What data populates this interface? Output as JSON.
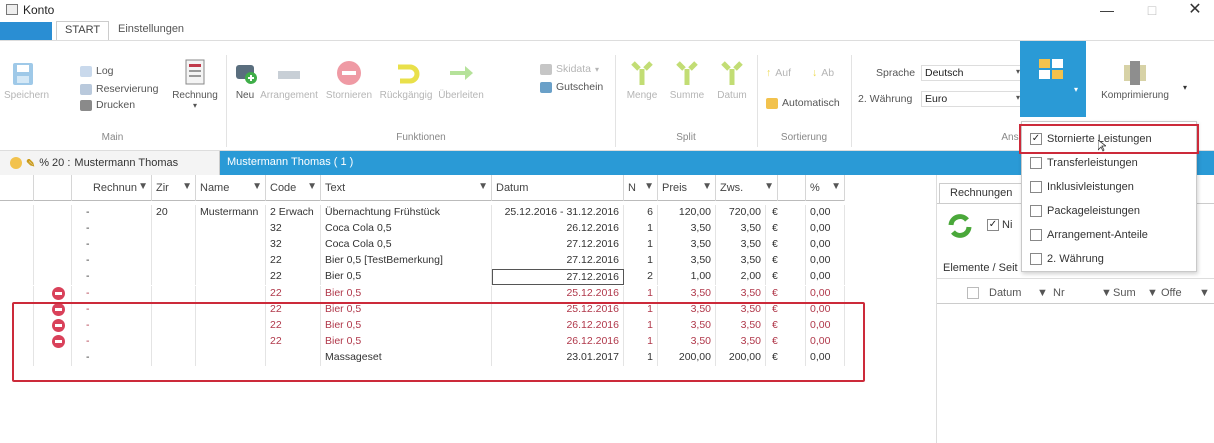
{
  "window": {
    "title": "Konto",
    "min": "—",
    "max": "□",
    "close": "✕"
  },
  "ribbon_tabs": [
    "START",
    "Einstellungen"
  ],
  "groups": {
    "main": "Main",
    "funktionen": "Funktionen",
    "split": "Split",
    "sortierung": "Sortierung",
    "ansicht": "Ans"
  },
  "main": {
    "speichern": "Speichern",
    "log": "Log",
    "reservierung": "Reservierung",
    "drucken": "Drucken",
    "rechnung": "Rechnung"
  },
  "funktionen": {
    "neu": "Neu",
    "arrangement": "Arrangement",
    "stornieren": "Stornieren",
    "rueckgaengig": "Rückgängig",
    "ueberleiten": "Überleiten",
    "skidata": "Skidata",
    "gutschein": "Gutschein"
  },
  "split": {
    "menge": "Menge",
    "summe": "Summe",
    "datum": "Datum"
  },
  "sortierung": {
    "auf": "Auf",
    "ab": "Ab",
    "automatisch": "Automatisch"
  },
  "settings": {
    "sprache_label": "Sprache",
    "sprache_value": "Deutsch",
    "waehrung_label": "2. Währung",
    "waehrung_value": "Euro",
    "komprimierung": "Komprimierung"
  },
  "doc_tabs": {
    "active_prefix": "% 20 :",
    "active_name": "Mustermann Thomas",
    "second": "Mustermann Thomas ( 1 )"
  },
  "columns": [
    "Rechnun",
    "Zir",
    "Name",
    "Code",
    "Text",
    "Datum",
    "N",
    "Preis",
    "Zws.",
    "",
    "%"
  ],
  "rows": [
    {
      "rechnung": "-",
      "zi": "20",
      "name": "Mustermann",
      "code": "2 Erwach",
      "text": "Übernachtung Frühstück",
      "datum": "25.12.2016 - 31.12.2016",
      "n": "6",
      "preis": "120,00",
      "zws": "720,00",
      "cur": "€",
      "pct": "0,00",
      "cancelled": false
    },
    {
      "rechnung": "-",
      "zi": "",
      "name": "",
      "code": "32",
      "text": "Coca Cola 0,5",
      "datum": "26.12.2016",
      "n": "1",
      "preis": "3,50",
      "zws": "3,50",
      "cur": "€",
      "pct": "0,00",
      "cancelled": false
    },
    {
      "rechnung": "-",
      "zi": "",
      "name": "",
      "code": "32",
      "text": "Coca Cola 0,5",
      "datum": "27.12.2016",
      "n": "1",
      "preis": "3,50",
      "zws": "3,50",
      "cur": "€",
      "pct": "0,00",
      "cancelled": false
    },
    {
      "rechnung": "-",
      "zi": "",
      "name": "",
      "code": "22",
      "text": "Bier 0,5 [TestBemerkung]",
      "datum": "27.12.2016",
      "n": "1",
      "preis": "3,50",
      "zws": "3,50",
      "cur": "€",
      "pct": "0,00",
      "cancelled": false
    },
    {
      "rechnung": "-",
      "zi": "",
      "name": "",
      "code": "22",
      "text": "Bier 0,5",
      "datum": "27.12.2016",
      "n": "2",
      "preis": "1,00",
      "zws": "2,00",
      "cur": "€",
      "pct": "0,00",
      "cancelled": false
    },
    {
      "rechnung": "-",
      "zi": "",
      "name": "",
      "code": "22",
      "text": "Bier 0,5",
      "datum": "25.12.2016",
      "n": "1",
      "preis": "3,50",
      "zws": "3,50",
      "cur": "€",
      "pct": "0,00",
      "cancelled": true
    },
    {
      "rechnung": "-",
      "zi": "",
      "name": "",
      "code": "22",
      "text": "Bier 0,5",
      "datum": "25.12.2016",
      "n": "1",
      "preis": "3,50",
      "zws": "3,50",
      "cur": "€",
      "pct": "0,00",
      "cancelled": true
    },
    {
      "rechnung": "-",
      "zi": "",
      "name": "",
      "code": "22",
      "text": "Bier 0,5",
      "datum": "26.12.2016",
      "n": "1",
      "preis": "3,50",
      "zws": "3,50",
      "cur": "€",
      "pct": "0,00",
      "cancelled": true
    },
    {
      "rechnung": "-",
      "zi": "",
      "name": "",
      "code": "22",
      "text": "Bier 0,5",
      "datum": "26.12.2016",
      "n": "1",
      "preis": "3,50",
      "zws": "3,50",
      "cur": "€",
      "pct": "0,00",
      "cancelled": true
    },
    {
      "rechnung": "-",
      "zi": "",
      "name": "",
      "code": "",
      "text": "Massageset",
      "datum": "23.01.2017",
      "n": "1",
      "preis": "200,00",
      "zws": "200,00",
      "cur": "€",
      "pct": "0,00",
      "cancelled": false
    }
  ],
  "side_panel": {
    "tab": "Rechnungen",
    "check_label": "Ni",
    "elements_label": "Elemente / Seit",
    "columns": [
      "Datum",
      "Nr",
      "Sum",
      "Offe"
    ]
  },
  "dropdown": [
    {
      "label": "Stornierte Leistungen",
      "checked": true
    },
    {
      "label": "Transferleistungen",
      "checked": false
    },
    {
      "label": "Inklusivleistungen",
      "checked": false
    },
    {
      "label": "Packageleistungen",
      "checked": false
    },
    {
      "label": "Arrangement-Anteile",
      "checked": false
    },
    {
      "label": "2. Währung",
      "checked": false
    }
  ],
  "colors": {
    "accent_blue": "#2a9ad6",
    "cancel_red": "#b0384a",
    "highlight_red": "#cc2a3a"
  }
}
